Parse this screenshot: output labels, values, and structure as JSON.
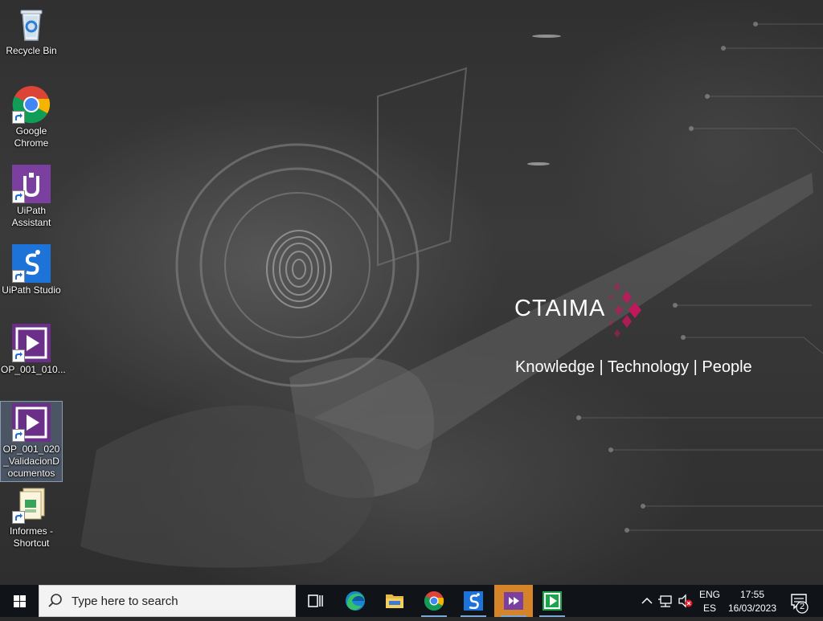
{
  "wallpaper": {
    "brand": "CTAIMA",
    "tagline": "Knowledge | Technology | People",
    "accent_color": "#c2185b"
  },
  "desktop_icons": [
    {
      "label": "Recycle Bin",
      "icon": "recycle-bin-icon"
    },
    {
      "label": "Google Chrome",
      "icon": "chrome-icon"
    },
    {
      "label": "UiPath Assistant",
      "icon": "uipath-assistant-icon"
    },
    {
      "label": "UiPath Studio",
      "icon": "uipath-studio-icon"
    },
    {
      "label": "OP_001_010...",
      "icon": "uipath-process-icon"
    },
    {
      "label": "OP_001_020_ValidacionDocumentos",
      "icon": "uipath-process-icon"
    },
    {
      "label": "Informes - Shortcut",
      "icon": "folder-shortcut-icon"
    }
  ],
  "taskbar": {
    "search_placeholder": "Type here to search",
    "pinned": [
      {
        "name": "task-view",
        "icon": "task-view-icon"
      },
      {
        "name": "edge",
        "icon": "edge-icon"
      },
      {
        "name": "file-explorer",
        "icon": "folder-icon"
      },
      {
        "name": "chrome",
        "icon": "chrome-icon"
      },
      {
        "name": "uipath-studio",
        "icon": "uipath-studio-icon"
      },
      {
        "name": "uipath-assistant",
        "icon": "uipath-assistant-icon"
      },
      {
        "name": "uipath-robot",
        "icon": "uipath-robot-icon"
      }
    ],
    "tray": {
      "language": "ENG",
      "layout": "ES",
      "time": "17:55",
      "date": "16/03/2023",
      "notifications_count": "2"
    },
    "colors": {
      "background": "#101418",
      "active": "#d6842a",
      "running_indicator": "#7aa9d9"
    }
  }
}
